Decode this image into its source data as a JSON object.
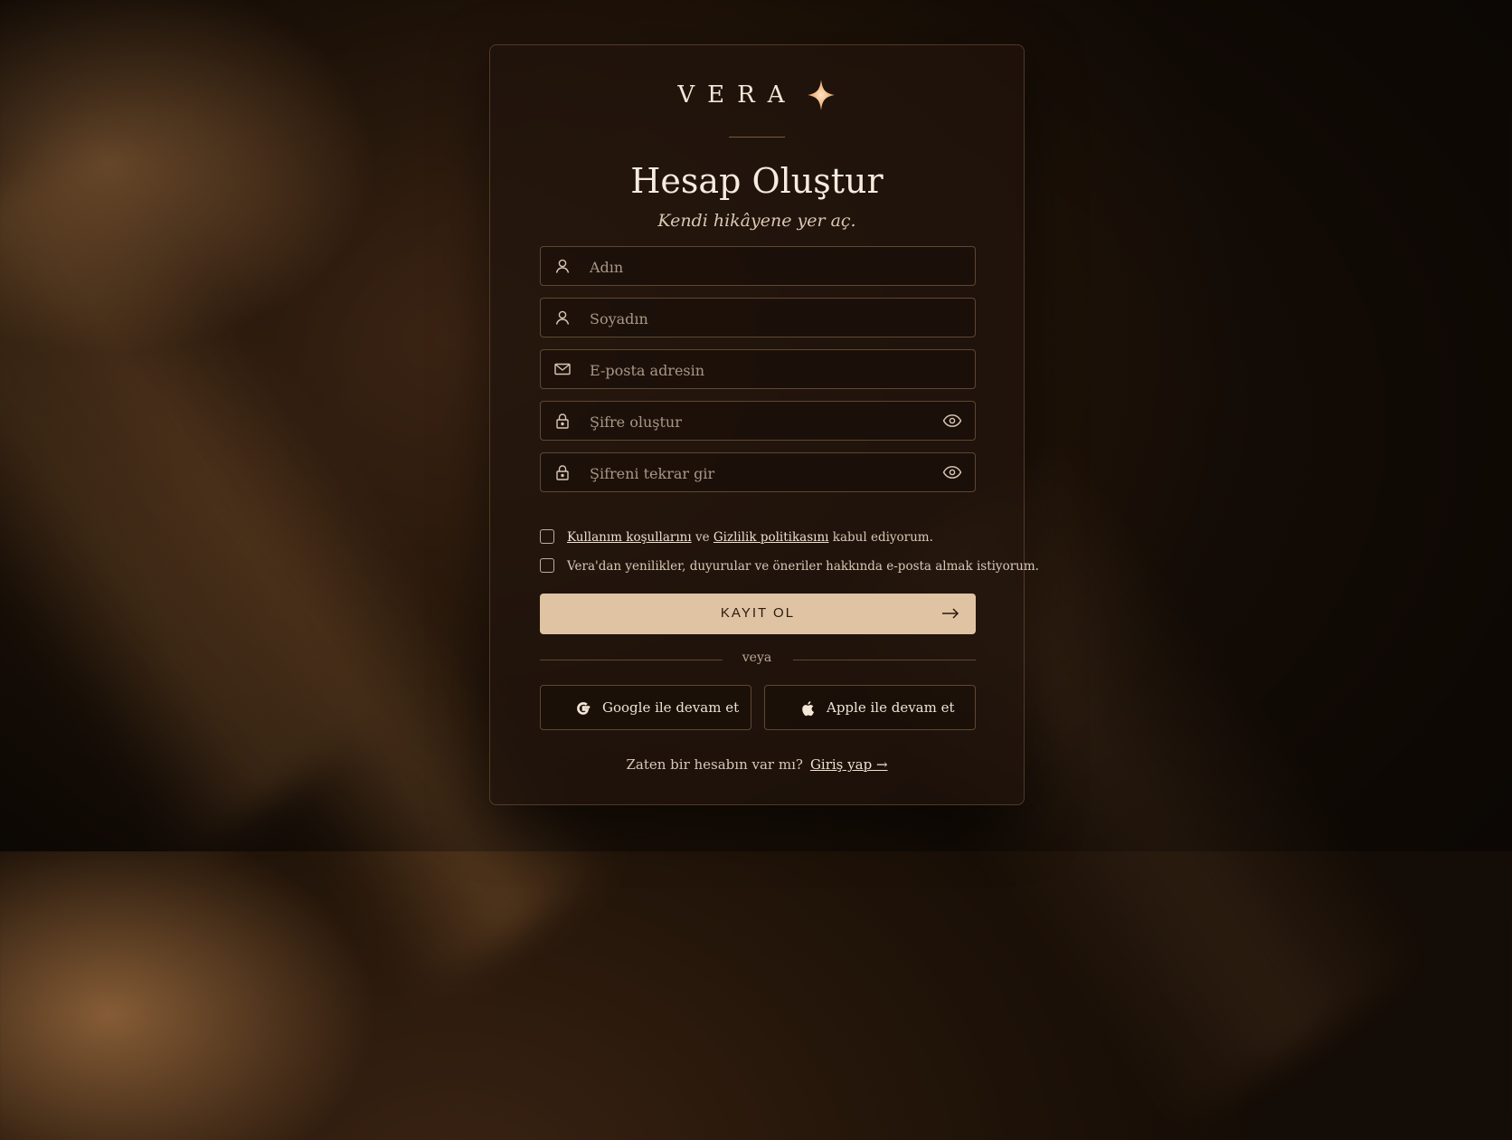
{
  "brand": {
    "name": "VERA",
    "accent": "#e8a874"
  },
  "heading": {
    "title": "Hesap Oluştur",
    "subtitle": "Kendi hikâyene yer aç."
  },
  "fields": {
    "first_name": {
      "placeholder": "Adın",
      "icon": "user-icon"
    },
    "last_name": {
      "placeholder": "Soyadın",
      "icon": "user-icon"
    },
    "email": {
      "placeholder": "E-posta adresin",
      "icon": "mail-icon"
    },
    "password": {
      "placeholder": "Şifre oluştur",
      "icon": "lock-icon",
      "toggle_icon": "eye-icon"
    },
    "password_confirm": {
      "placeholder": "Şifreni tekrar gir",
      "icon": "lock-icon",
      "toggle_icon": "eye-icon"
    }
  },
  "consent": {
    "terms_link": "Kullanım koşullarını",
    "and_word": "ve",
    "privacy_link": "Gizlilik politikasını",
    "accept_suffix": "kabul ediyorum.",
    "terms_checked": false,
    "newsletter_text": "Vera'dan yenilikler, duyurular ve öneriler hakkında e-posta almak istiyorum.",
    "newsletter_checked": false
  },
  "submit": {
    "label": "KAYIT OL",
    "icon": "arrow-right-icon",
    "color": "#dfc3a3"
  },
  "separator": {
    "label": "veya"
  },
  "social": {
    "google_label": "Google ile devam et",
    "apple_label": "Apple ile devam et"
  },
  "footer": {
    "question": "Zaten bir hesabın var mı?",
    "login_link": "Giriş yap →"
  }
}
